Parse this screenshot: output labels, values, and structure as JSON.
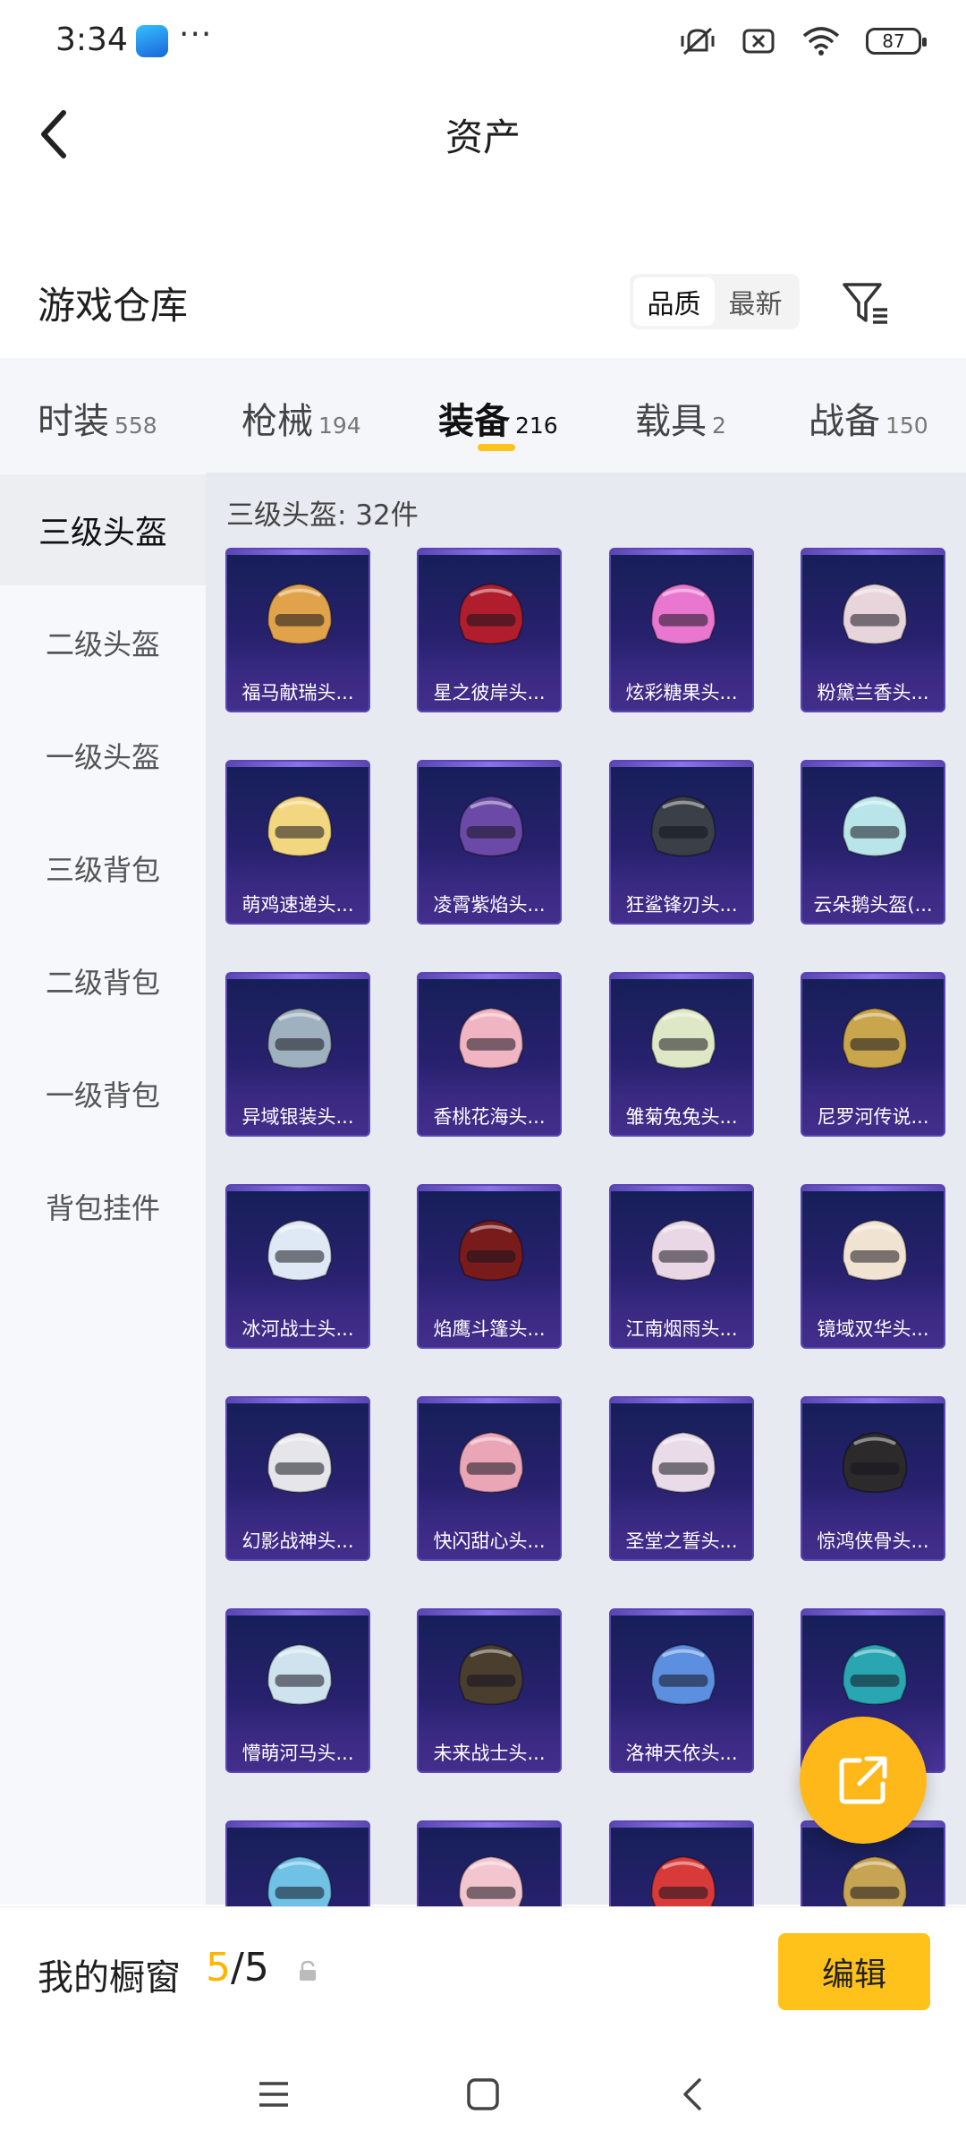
{
  "status_bar": {
    "time": "3:34",
    "overflow": "···",
    "battery": "87"
  },
  "header": {
    "title": "资产",
    "back_icon": "chevron-left-icon"
  },
  "section": {
    "title": "游戏仓库",
    "sort_options": [
      "品质",
      "最新"
    ],
    "sort_selected": "品质",
    "filter_icon": "filter-icon"
  },
  "tabs": [
    {
      "label": "时装",
      "count": "558"
    },
    {
      "label": "枪械",
      "count": "194"
    },
    {
      "label": "装备",
      "count": "216",
      "active": true
    },
    {
      "label": "载具",
      "count": "2"
    },
    {
      "label": "战备",
      "count": "150"
    }
  ],
  "categories": [
    {
      "label": "三级头盔",
      "active": true
    },
    {
      "label": "二级头盔"
    },
    {
      "label": "一级头盔"
    },
    {
      "label": "三级背包"
    },
    {
      "label": "二级背包"
    },
    {
      "label": "一级背包"
    },
    {
      "label": "背包挂件"
    }
  ],
  "grid": {
    "header": "三级头盔: 32件",
    "items": [
      {
        "name": "福马献瑞头...",
        "color": "#e0a24a"
      },
      {
        "name": "星之彼岸头...",
        "color": "#b01e2d"
      },
      {
        "name": "炫彩糖果头...",
        "color": "#e977cf"
      },
      {
        "name": "粉黛兰香头...",
        "color": "#e8d5dc"
      },
      {
        "name": "萌鸡速递头...",
        "color": "#f2d680"
      },
      {
        "name": "凌霄紫焰头...",
        "color": "#6a4aa6"
      },
      {
        "name": "狂鲨锋刃头...",
        "color": "#3b3f47"
      },
      {
        "name": "云朵鹅头盔(...",
        "color": "#b9e5ea"
      },
      {
        "name": "异域银装头...",
        "color": "#9fb1bf"
      },
      {
        "name": "香桃花海头...",
        "color": "#f1b4c2"
      },
      {
        "name": "雏菊兔兔头...",
        "color": "#dfe8c6"
      },
      {
        "name": "尼罗河传说...",
        "color": "#c9a54c"
      },
      {
        "name": "冰河战士头...",
        "color": "#dfe9f5"
      },
      {
        "name": "焰鹰斗篷头...",
        "color": "#7a1b1b"
      },
      {
        "name": "江南烟雨头...",
        "color": "#ead7e6"
      },
      {
        "name": "镜域双华头...",
        "color": "#f1e3d1"
      },
      {
        "name": "幻影战神头...",
        "color": "#e6e6ea"
      },
      {
        "name": "快闪甜心头...",
        "color": "#eaa5b6"
      },
      {
        "name": "圣堂之誓头...",
        "color": "#e9dbe8"
      },
      {
        "name": "惊鸿侠骨头...",
        "color": "#2d2a2b"
      },
      {
        "name": "懵萌河马头...",
        "color": "#cfe3ee"
      },
      {
        "name": "未来战士头...",
        "color": "#4a3f2f"
      },
      {
        "name": "洛神天依头...",
        "color": "#5d8fe0"
      },
      {
        "name": "",
        "color": "#2aa6b3"
      },
      {
        "name": "",
        "color": "#6fc1e6"
      },
      {
        "name": "",
        "color": "#f3c6cf"
      },
      {
        "name": "",
        "color": "#d83a3a"
      },
      {
        "name": "",
        "color": "#c7a453"
      }
    ]
  },
  "fab": {
    "icon": "share-external-icon"
  },
  "showcase": {
    "label": "我的橱窗",
    "used": "5",
    "sep": "/",
    "total": "5",
    "lock_icon": "lock-icon",
    "edit_label": "编辑"
  },
  "system_nav": [
    "menu-icon",
    "home-square-icon",
    "back-icon"
  ]
}
